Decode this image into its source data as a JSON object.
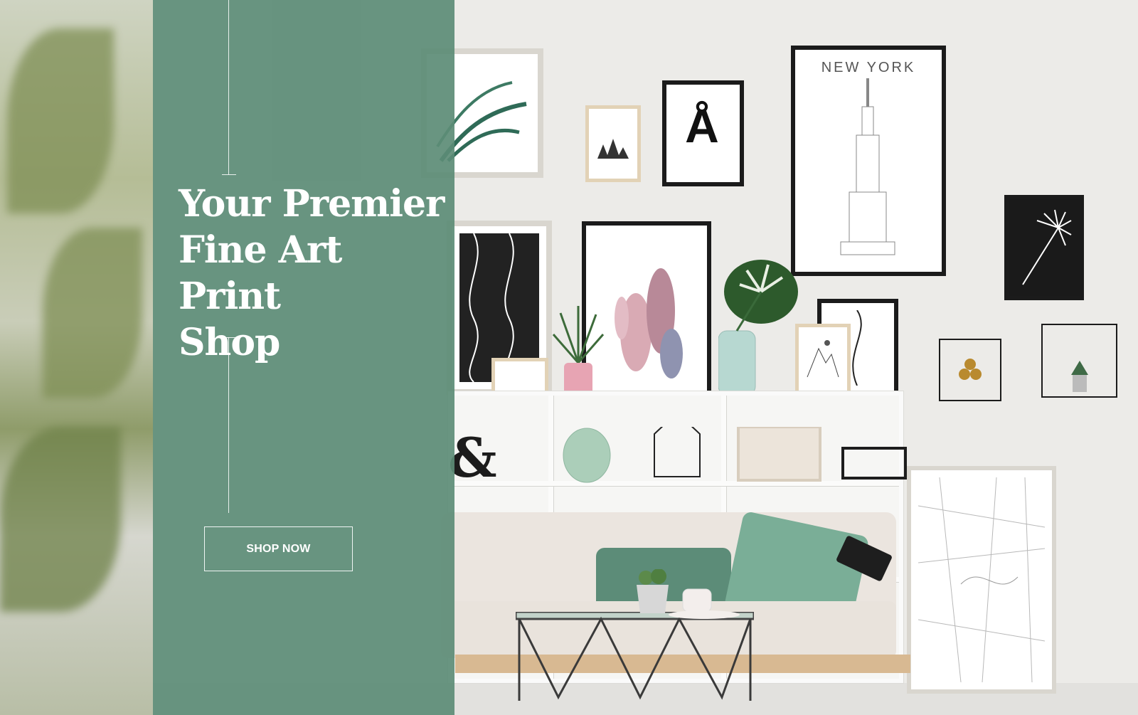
{
  "hero": {
    "headline_line1": "Your Premier",
    "headline_line2": "Fine Art Print",
    "headline_line3": "Shop",
    "cta_label": "SHOP NOW"
  },
  "artwork": {
    "new_york_caption": "NEW YORK",
    "letter_print": "Å"
  },
  "colors": {
    "panel": "#5c8c76",
    "text": "#ffffff"
  }
}
